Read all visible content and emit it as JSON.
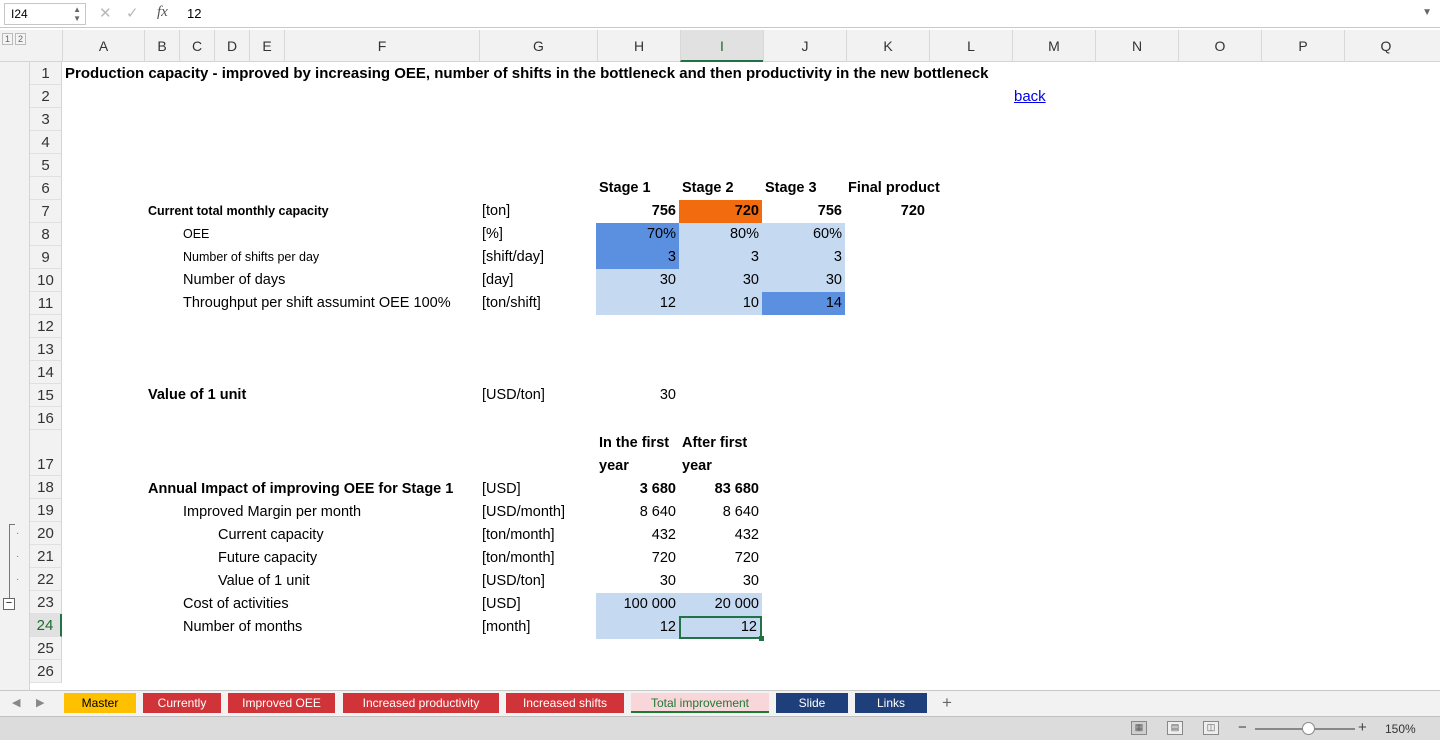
{
  "formula_bar": {
    "name_box": "I24",
    "cancel_icon": "✕",
    "enter_icon": "✓",
    "fx_label": "fx",
    "value": "12"
  },
  "outline_levels": [
    "1",
    "2"
  ],
  "columns": [
    "A",
    "B",
    "C",
    "D",
    "E",
    "F",
    "G",
    "H",
    "I",
    "J",
    "K",
    "L",
    "M",
    "N",
    "O",
    "P",
    "Q"
  ],
  "selected_column": "I",
  "rows": [
    "1",
    "2",
    "3",
    "4",
    "5",
    "6",
    "7",
    "8",
    "9",
    "10",
    "11",
    "12",
    "13",
    "14",
    "15",
    "16",
    "17",
    "18",
    "19",
    "20",
    "21",
    "22",
    "23",
    "24",
    "25",
    "26"
  ],
  "selected_row": "24",
  "sheet": {
    "title": "Production capacity - improved by increasing OEE, number of shifts in the bottleneck and then productivity in the new bottleneck",
    "back_link": "back",
    "stage_headers": [
      "Stage 1",
      "Stage 2",
      "Stage 3",
      "Final product"
    ],
    "capacity": {
      "label": "Current total monthly capacity",
      "unit": "[ton]",
      "values": [
        "756",
        "720",
        "756",
        "720"
      ]
    },
    "oee": {
      "label": "OEE",
      "unit": "[%]",
      "values": [
        "70%",
        "80%",
        "60%"
      ]
    },
    "shifts": {
      "label": "Number of shifts per day",
      "unit": "[shift/day]",
      "values": [
        "3",
        "3",
        "3"
      ]
    },
    "days": {
      "label": "Number of days",
      "unit": "[day]",
      "values": [
        "30",
        "30",
        "30"
      ]
    },
    "throughput": {
      "label": "Throughput per shift assumint OEE 100%",
      "unit": "[ton/shift]",
      "values": [
        "12",
        "10",
        "14"
      ]
    },
    "unit_value": {
      "label": "Value of 1 unit",
      "unit": "[USD/ton]",
      "value": "30"
    },
    "impact_headers": {
      "first_line1": "In the first",
      "first_line2": "year",
      "after_line1": "After first",
      "after_line2": "year"
    },
    "impact_rows": [
      {
        "label": "Annual Impact of improving OEE for Stage 1",
        "unit": "[USD]",
        "first": "3 680",
        "after": "83 680"
      },
      {
        "label": "Improved Margin per month",
        "unit": "[USD/month]",
        "first": "8 640",
        "after": "8 640"
      },
      {
        "label": "Current capacity",
        "unit": "[ton/month]",
        "first": "432",
        "after": "432"
      },
      {
        "label": "Future capacity",
        "unit": "[ton/month]",
        "first": "720",
        "after": "720"
      },
      {
        "label": "Value of 1 unit",
        "unit": "[USD/ton]",
        "first": "30",
        "after": "30"
      },
      {
        "label": "Cost of activities",
        "unit": "[USD]",
        "first": "100 000",
        "after": "20 000"
      },
      {
        "label": "Number of months",
        "unit": "[month]",
        "first": "12",
        "after": "12"
      }
    ]
  },
  "tabs": [
    {
      "label": "Master",
      "color": "#ffc000",
      "text_color": "#000000"
    },
    {
      "label": "Currently",
      "color": "#d13438",
      "text_color": "#ffffff"
    },
    {
      "label": "Improved OEE",
      "color": "#d13438",
      "text_color": "#ffffff"
    },
    {
      "label": "Increased productivity",
      "color": "#d13438",
      "text_color": "#ffffff"
    },
    {
      "label": "Increased shifts",
      "color": "#d13438",
      "text_color": "#ffffff"
    },
    {
      "label": "Total improvement",
      "color": "#f9d6d9",
      "text_color": "#1c7a35",
      "active": true
    },
    {
      "label": "Slide",
      "color": "#1f3f7a",
      "text_color": "#ffffff"
    },
    {
      "label": "Links",
      "color": "#1f3f7a",
      "text_color": "#ffffff"
    }
  ],
  "add_tab": "+",
  "status": {
    "zoom": "150%",
    "zoom_minus": "−",
    "zoom_plus": "+"
  },
  "colors": {
    "fill_light": "#c5d9f1",
    "fill_mid": "#5b8fe0",
    "fill_orange": "#f26b0f",
    "selection": "#217346"
  }
}
